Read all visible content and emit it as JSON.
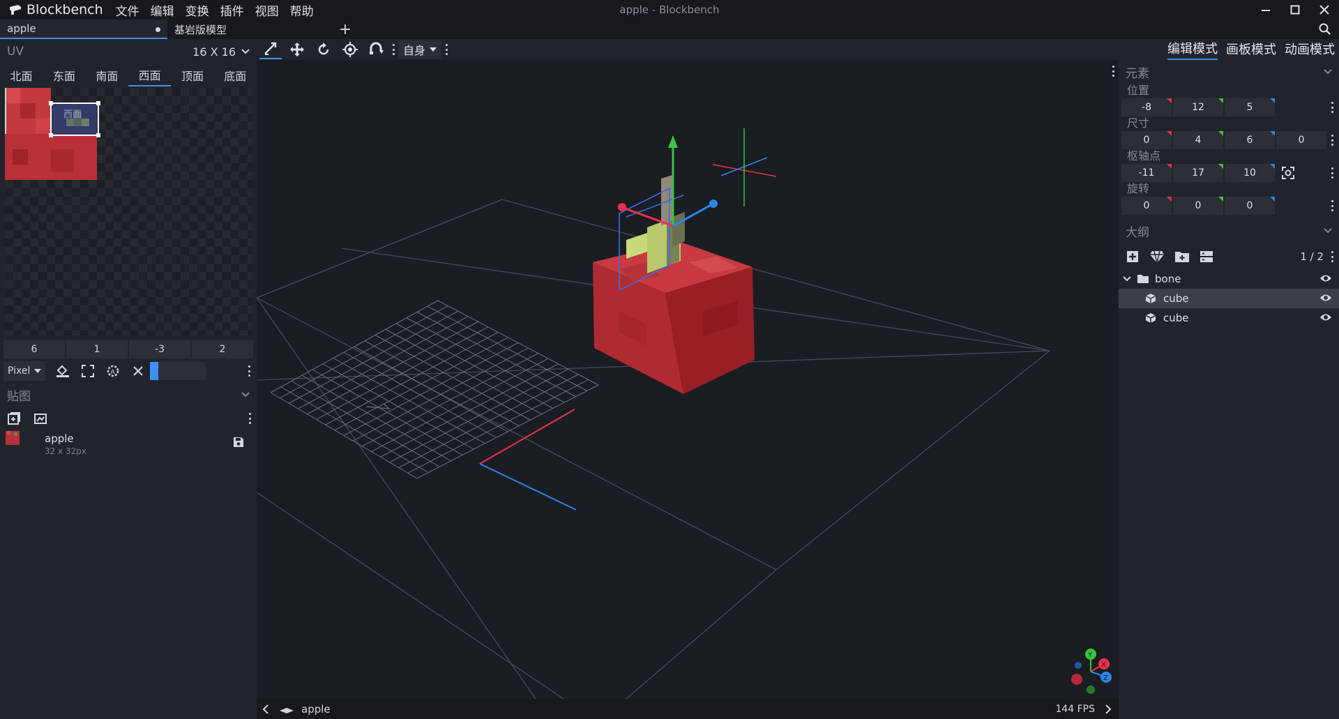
{
  "app": {
    "name": "Blockbench",
    "window_title": "apple - Blockbench",
    "menu": [
      "文件",
      "编辑",
      "变换",
      "插件",
      "视图",
      "帮助"
    ]
  },
  "tabs": [
    {
      "label": "apple",
      "unsaved": true,
      "active": true
    },
    {
      "label": "基岩版模型",
      "active": false
    }
  ],
  "uv": {
    "title": "UV",
    "resolution": "16 X 16",
    "faces": [
      "北面",
      "东面",
      "南面",
      "西面",
      "顶面",
      "底面"
    ],
    "active_face": "西面",
    "face_label": "西面",
    "values": [
      "6",
      "1",
      "-3",
      "2"
    ]
  },
  "paint": {
    "mode": "Pixel"
  },
  "textures": {
    "title": "贴图",
    "items": [
      {
        "name": "apple",
        "size": "32 x 32px"
      }
    ]
  },
  "toolbar": {
    "space": "自身"
  },
  "modes": {
    "edit": "编辑模式",
    "paint": "画板模式",
    "animate": "动画模式",
    "active": "编辑模式"
  },
  "element": {
    "title": "元素",
    "position_label": "位置",
    "position": [
      "-8",
      "12",
      "5"
    ],
    "size_label": "尺寸",
    "size": [
      "0",
      "4",
      "6",
      "0"
    ],
    "pivot_label": "枢轴点",
    "pivot": [
      "-11",
      "17",
      "10"
    ],
    "rotation_label": "旋转",
    "rotation": [
      "0",
      "0",
      "0"
    ]
  },
  "outliner": {
    "title": "大纲",
    "count": "1 / 2",
    "group": "bone",
    "items": [
      {
        "name": "cube",
        "selected": true
      },
      {
        "name": "cube",
        "selected": false
      }
    ]
  },
  "status": {
    "model": "apple",
    "fps": "144 FPS"
  },
  "gizmo": {
    "x": "X",
    "y": "Y",
    "z": "Z"
  },
  "colors": {
    "accent": "#3e90ff",
    "axis_x": "#e8324a",
    "axis_y": "#3ac43f",
    "axis_z": "#2a86e8",
    "apple_red": "#b3262d"
  }
}
